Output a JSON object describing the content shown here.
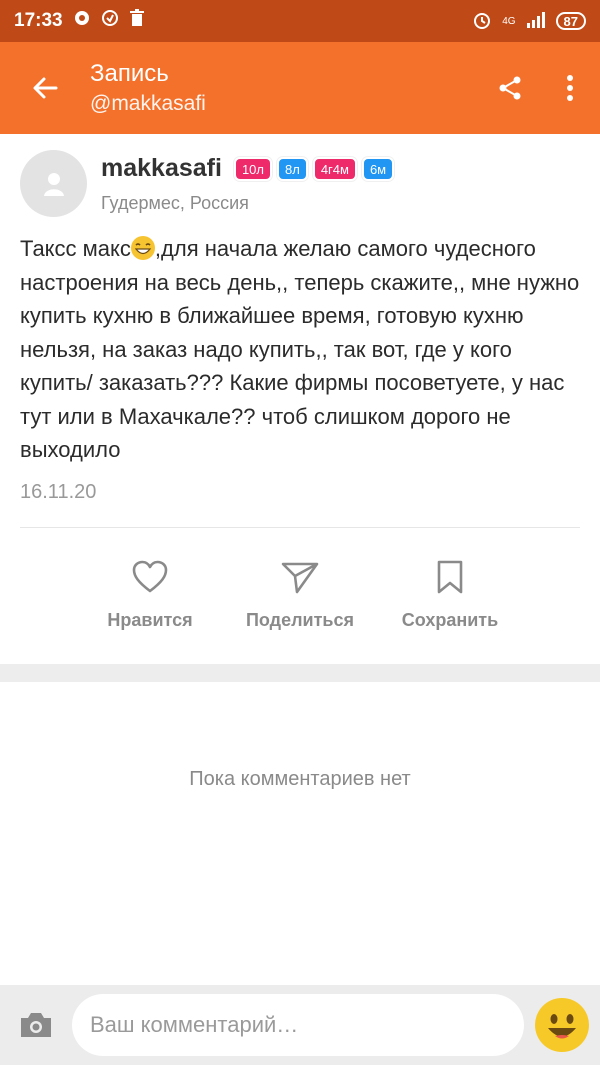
{
  "status_bar": {
    "time": "17:33",
    "battery": "87",
    "network": "4G"
  },
  "app_bar": {
    "title": "Запись",
    "subtitle": "@makkasafi"
  },
  "post": {
    "author": "makkasafi",
    "badges": [
      {
        "label": "10л",
        "color": "#ee2a6b"
      },
      {
        "label": "8л",
        "color": "#2196f3"
      },
      {
        "label": "4г4м",
        "color": "#ee2a6b"
      },
      {
        "label": "6м",
        "color": "#2196f3"
      }
    ],
    "location": "Гудермес, Россия",
    "text_before_emoji": "Таксс макс",
    "text_after_emoji": ",для начала желаю самого чудесного настроения на весь день,, теперь скажите,, мне нужно купить кухню в ближайшее время, готовую кухню нельзя, на заказ надо купить,, так вот, где у кого купить/ заказать??? Какие фирмы посоветуете, у нас тут или в Махачкале?? чтоб слишком дорого не выходило",
    "date": "16.11.20"
  },
  "actions": {
    "like": "Нравится",
    "share": "Поделиться",
    "save": "Сохранить"
  },
  "comments": {
    "empty_text": "Пока комментариев нет",
    "input_placeholder": "Ваш комментарий…"
  },
  "colors": {
    "status_bar": "#bf4a17",
    "app_bar": "#f3712b",
    "badge_pink": "#ee2a6b",
    "badge_blue": "#2196f3",
    "icon_gray": "#8a8a8a"
  }
}
